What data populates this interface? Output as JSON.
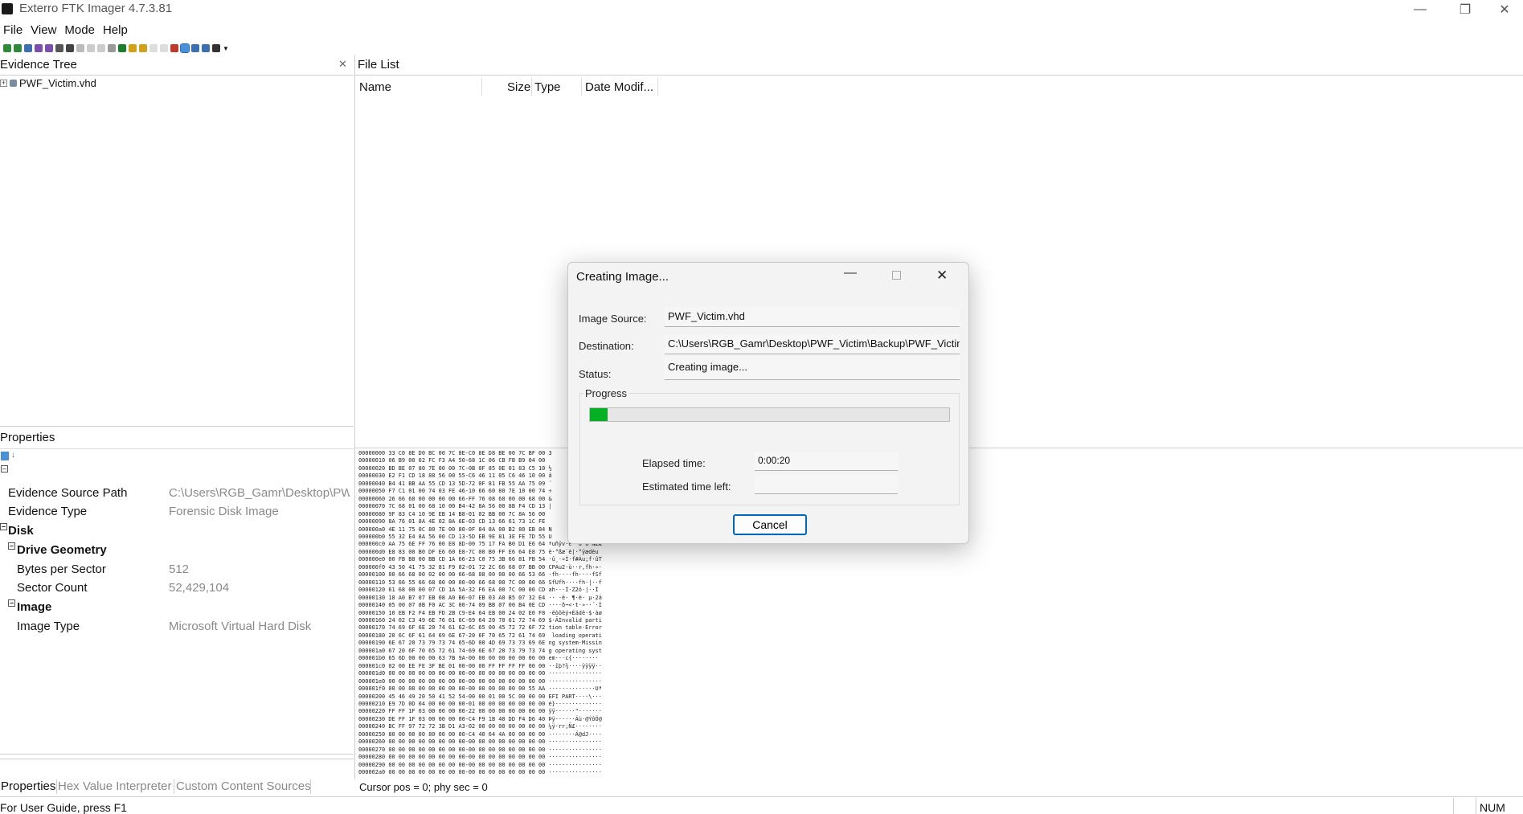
{
  "window": {
    "title": "Exterro FTK Imager 4.7.3.81"
  },
  "menu": [
    "File",
    "View",
    "Mode",
    "Help"
  ],
  "evidence_tree": {
    "title": "Evidence Tree",
    "items": [
      {
        "label": "PWF_Victim.vhd"
      }
    ]
  },
  "file_list": {
    "title": "File List",
    "columns": [
      "Name",
      "Size",
      "Type",
      "Date Modif..."
    ]
  },
  "properties": {
    "title": "Properties",
    "rows": [
      {
        "name": "Evidence Source Path",
        "value": "C:\\Users\\RGB_Gamr\\Desktop\\PW"
      },
      {
        "name": "Evidence Type",
        "value": "Forensic Disk Image"
      }
    ],
    "group_disk": "Disk",
    "group_drive_geometry": "Drive Geometry",
    "drive_rows": [
      {
        "name": "Bytes per Sector",
        "value": "512"
      },
      {
        "name": "Sector Count",
        "value": "52,429,104"
      }
    ],
    "group_image": "Image",
    "image_rows": [
      {
        "name": "Image Type",
        "value": "Microsoft Virtual Hard Disk"
      }
    ]
  },
  "bottom_tabs": [
    "Properties",
    "Hex Value Interpreter",
    "Custom Content Sources"
  ],
  "cursor_status": "Cursor pos = 0; phy sec = 0",
  "statusbar": {
    "hint": "For User Guide, press F1",
    "num": "NUM"
  },
  "hex_lines": [
    "00000000 33 C0 8E D0 BC 00 7C 8E-C0 8E D8 BE 00 7C BF 00 3",
    "00000010 06 B9 00 02 FC F3 A4 50-68 1C 06 CB FB B9 04 00",
    "00000020 BD BE 07 80 7E 00 00 7C-0B 0F 85 0E 01 83 C5 10 ½",
    "00000030 E2 F1 CD 18 88 56 00 55-C6 46 11 05 C6 46 10 00 â",
    "00000040 B4 41 BB AA 55 CD 13 5D-72 0F 81 FB 55 AA 75 09 ´",
    "00000050 F7 C1 01 00 74 03 FE 46-10 66 60 80 7E 10 00 74 ÷",
    "00000060 26 66 68 00 00 00 00 66-FF 76 08 68 00 00 68 00 &",
    "00000070 7C 68 01 00 68 10 00 B4-42 8A 56 00 8B F4 CD 13 |",
    "00000080 9F 83 C4 10 9E EB 14 B8-01 02 BB 00 7C 8A 56 00 ",
    "00000090 8A 76 01 8A 4E 02 8A 6E-03 CD 13 66 61 73 1C FE ",
    "000000a0 4E 11 75 0C 80 7E 00 80-0F 84 8A 00 B2 80 EB 84 N",
    "000000b0 55 32 E4 8A 56 00 CD 13-5D EB 9E 81 3E FE 7D 55 U",
    "000000c0 AA 75 6E FF 76 00 E8 8D-00 75 17 FA B0 D1 E6 64 ªuñÿv·è··u·ú°ÑæÆ",
    "000000d0 E8 83 00 B0 DF E6 60 E8-7C 00 B0 FF E6 64 E8 75 è·°ßæ`è|·°ÿædèu",
    "000000e0 00 FB B8 00 BB CD 1A 66-23 C0 75 3B 66 81 FB 54 ·û¸·»Í·f#Àu;f·ûT",
    "000000f0 43 50 41 75 32 81 F9 02-01 72 2C 66 68 07 BB 00 CPAu2·ù··r,fh·»·",
    "00000100 00 66 68 00 02 00 00 66-68 08 00 00 00 66 53 66 ·fh····fh····fSf",
    "00000110 53 66 55 66 68 00 00 00-00 66 68 00 7C 00 00 66 SfUfh····fh·|··f",
    "00000120 61 68 00 00 07 CD 1A 5A-32 F6 EA 00 7C 00 00 CD ah···Í·Z2ö·|··Í",
    "00000130 18 A0 B7 07 EB 08 A0 B6-07 EB 03 A0 B5 07 32 E4 ·· ·ë· ¶·ë· µ·2ä",
    "00000140 05 00 07 8B F0 AC 3C 00-74 09 BB 07 00 B4 0E CD ····ð¬<·t·»··´·Í",
    "00000150 10 EB F2 F4 EB FD 2B C9-E4 64 EB 00 24 02 E0 F8 ·ëòôëý+Éädë·$·àø",
    "00000160 24 02 C3 49 6E 76 61 6C-69 64 20 70 61 72 74 69 $·ÃInvalid parti",
    "00000170 74 69 6F 6E 20 74 61 62-6C 65 00 45 72 72 6F 72 tion table·Error",
    "00000180 20 6C 6F 61 64 69 6E 67-20 6F 70 65 72 61 74 69  loading operati",
    "00000190 6E 67 20 73 79 73 74 65-6D 00 4D 69 73 73 69 6E ng system·Missin",
    "000001a0 67 20 6F 70 65 72 61 74-69 6E 67 20 73 79 73 74 g operating syst",
    "000001b0 65 6D 00 00 00 63 7B 9A-00 00 00 00 00 00 00 00 em···c{········",
    "000001c0 02 00 EE FE 3F BE 01 00-00 00 FF FF FF FF 00 00 ··îþ?¾····ÿÿÿÿ··",
    "000001d0 00 00 00 00 00 00 00 00-00 00 00 00 00 00 00 00 ················",
    "000001e0 00 00 00 00 00 00 00 00-00 00 00 00 00 00 00 00 ················",
    "000001f0 00 00 00 00 00 00 00 00-00 00 00 00 00 00 55 AA ··············Uª",
    "00000200 45 46 49 20 50 41 52 54-00 00 01 00 5C 00 00 00 EFI PART····\\···",
    "00000210 E9 7D 0D 04 00 00 00 00-01 00 00 00 00 00 00 00 é}··············",
    "00000220 FF FF 1F 03 00 00 00 00-22 00 00 00 00 00 00 00 ÿÿ······\"·······",
    "00000230 DE FF 1F 03 00 00 00 00-C4 F9 1B 40 DD F4 D6 40 Þÿ······Äù·@ÝôÖ@",
    "00000240 BC FF 97 72 72 3B D1 A3-02 00 00 00 00 00 00 00 ¼ÿ·rr;Ñ£········",
    "00000250 80 00 00 00 80 00 00 00-C4 40 64 4A 00 00 00 00 ········Ä@dJ····",
    "00000260 00 00 00 00 00 00 00 00-00 00 00 00 00 00 00 00 ················",
    "00000270 00 00 00 00 00 00 00 00-00 00 00 00 00 00 00 00 ················",
    "00000280 00 00 00 00 00 00 00 00-00 00 00 00 00 00 00 00 ················",
    "00000290 00 00 00 00 00 00 00 00-00 00 00 00 00 00 00 00 ················",
    "000002a0 00 00 00 00 00 00 00 00-00 00 00 00 00 00 00 00 ················"
  ],
  "dialog": {
    "title": "Creating Image...",
    "source_label": "Image Source:",
    "source_value": "PWF_Victim.vhd",
    "dest_label": "Destination:",
    "dest_value": "C:\\Users\\RGB_Gamr\\Desktop\\PWF_Victim\\Backup\\PWF_Victim",
    "status_label": "Status:",
    "status_value": "Creating image...",
    "progress_label": "Progress",
    "progress_fraction": 0.05,
    "elapsed_label": "Elapsed time:",
    "elapsed_value": "0:00:20",
    "remaining_label": "Estimated time left:",
    "remaining_value": "",
    "cancel_label": "Cancel"
  },
  "colors": {
    "progress": "#06b025",
    "button_border": "#0067c0"
  }
}
